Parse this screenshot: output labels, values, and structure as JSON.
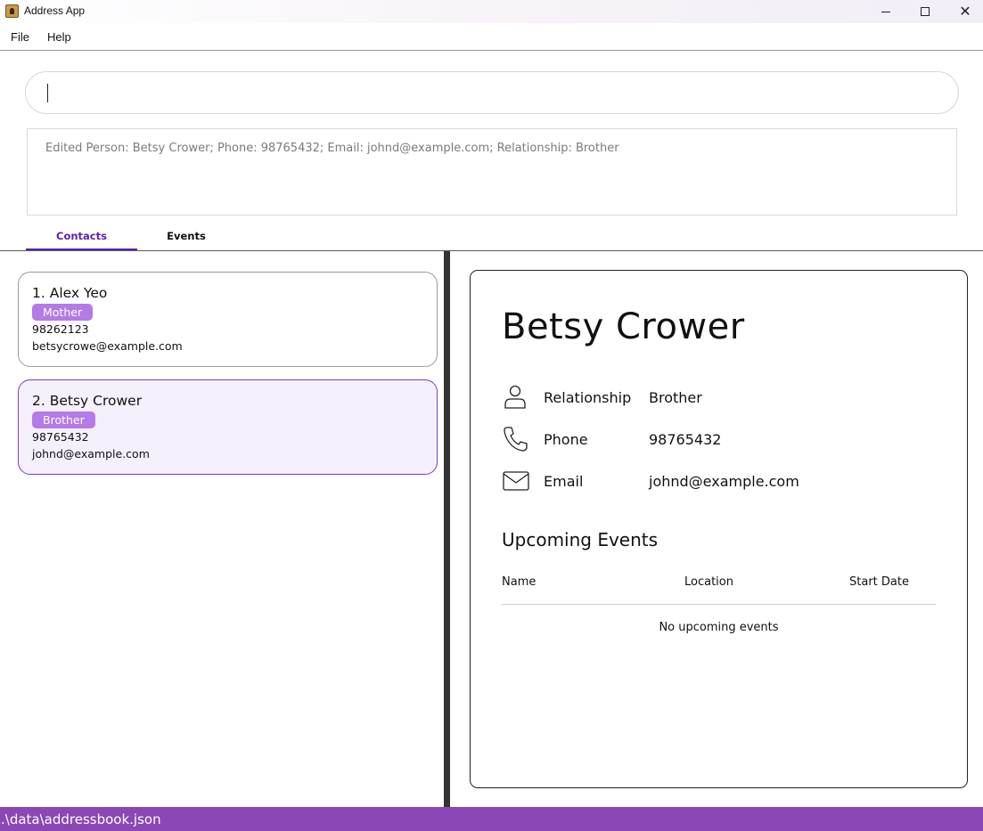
{
  "window": {
    "title": "Address App",
    "close_glyph": "✕"
  },
  "menu": {
    "file": "File",
    "help": "Help"
  },
  "command": {
    "value": ""
  },
  "result": {
    "text": "Edited Person: Betsy Crower; Phone: 98765432; Email: johnd@example.com; Relationship: Brother"
  },
  "tabs": {
    "contacts": "Contacts",
    "events": "Events",
    "active": "Contacts"
  },
  "contacts": [
    {
      "index_name": "1. Alex Yeo",
      "tag": "Mother",
      "phone": "98262123",
      "email": "betsycrowe@example.com"
    },
    {
      "index_name": "2. Betsy Crower",
      "tag": "Brother",
      "phone": "98765432",
      "email": "johnd@example.com",
      "selected": true
    }
  ],
  "detail": {
    "name": "Betsy Crower",
    "relationship_label": "Relationship",
    "relationship_value": "Brother",
    "phone_label": "Phone",
    "phone_value": "98765432",
    "email_label": "Email",
    "email_value": "johnd@example.com",
    "upcoming_title": "Upcoming Events",
    "columns": {
      "name": "Name",
      "location": "Location",
      "start_date": "Start Date"
    },
    "empty_text": "No upcoming events"
  },
  "status": {
    "path": ".\\data\\addressbook.json"
  },
  "colors": {
    "accent": "#5b21b6",
    "tag": "#b47ae6",
    "status_bar": "#8a47b5",
    "selected_card_bg": "#f6effc"
  },
  "icons": [
    "app-icon",
    "minimize-icon",
    "maximize-icon",
    "close-icon",
    "person-icon",
    "phone-icon",
    "mail-icon"
  ]
}
